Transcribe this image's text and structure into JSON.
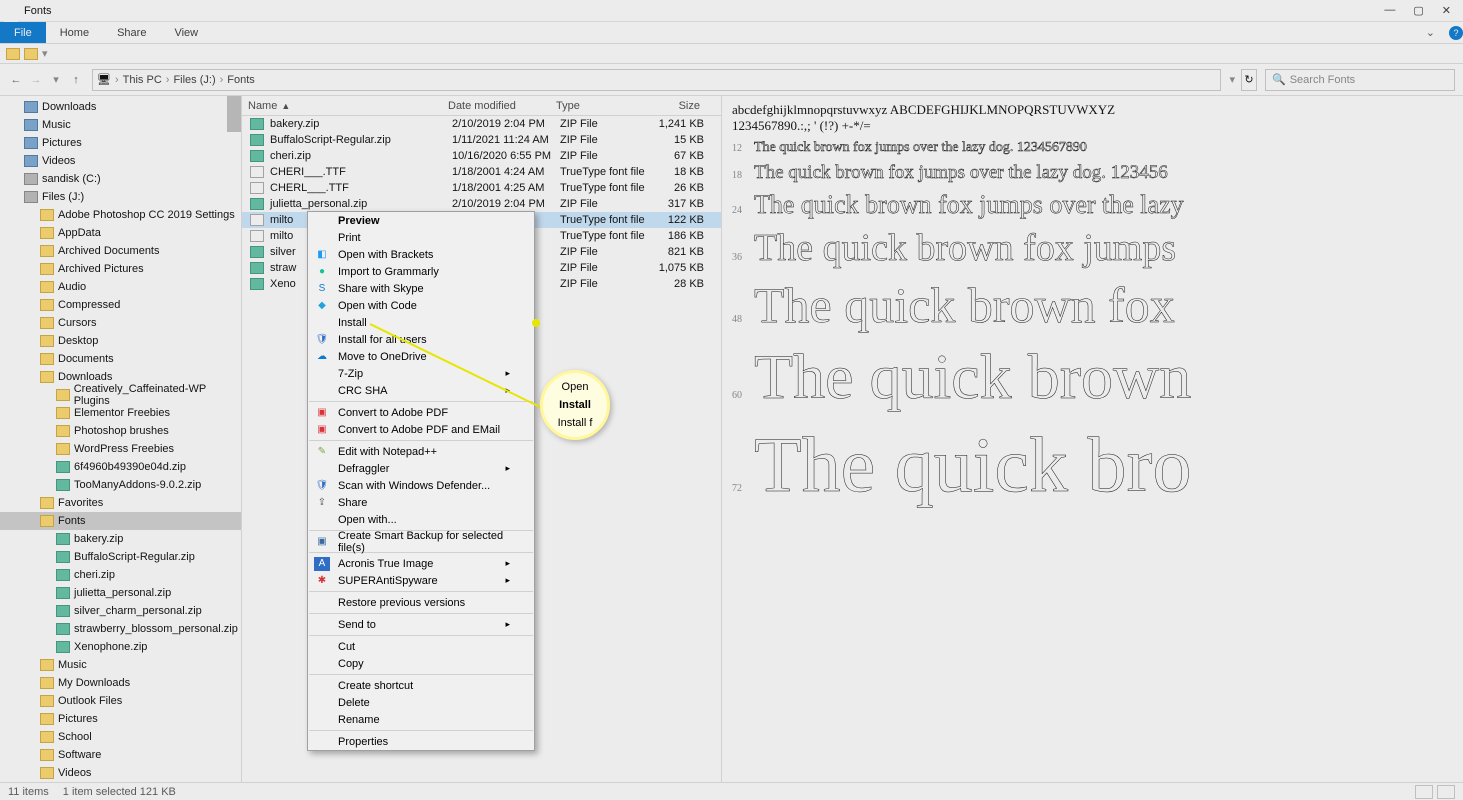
{
  "window": {
    "title": "Fonts"
  },
  "ribbon": {
    "file": "File",
    "home": "Home",
    "share": "Share",
    "view": "View"
  },
  "breadcrumb": {
    "root_icon": "pc",
    "parts": [
      "This PC",
      "Files (J:)",
      "Fonts"
    ],
    "refresh": "↻"
  },
  "search": {
    "placeholder": "Search Fonts"
  },
  "sidebar": {
    "items": [
      {
        "label": "Downloads",
        "ico": "lib",
        "lvl": 1
      },
      {
        "label": "Music",
        "ico": "lib",
        "lvl": 1
      },
      {
        "label": "Pictures",
        "ico": "lib",
        "lvl": 1
      },
      {
        "label": "Videos",
        "ico": "lib",
        "lvl": 1
      },
      {
        "label": "sandisk (C:)",
        "ico": "drive",
        "lvl": 1
      },
      {
        "label": "Files (J:)",
        "ico": "drive",
        "lvl": 1
      },
      {
        "label": "Adobe Photoshop CC 2019 Settings",
        "ico": "folder",
        "lvl": 2
      },
      {
        "label": "AppData",
        "ico": "folder",
        "lvl": 2
      },
      {
        "label": "Archived Documents",
        "ico": "folder",
        "lvl": 2
      },
      {
        "label": "Archived Pictures",
        "ico": "folder",
        "lvl": 2
      },
      {
        "label": "Audio",
        "ico": "folder",
        "lvl": 2
      },
      {
        "label": "Compressed",
        "ico": "folder",
        "lvl": 2
      },
      {
        "label": "Cursors",
        "ico": "folder",
        "lvl": 2
      },
      {
        "label": "Desktop",
        "ico": "folder",
        "lvl": 2
      },
      {
        "label": "Documents",
        "ico": "folder",
        "lvl": 2
      },
      {
        "label": "Downloads",
        "ico": "folder",
        "lvl": 2
      },
      {
        "label": "Creatively_Caffeinated-WP Plugins",
        "ico": "folder",
        "lvl": 3
      },
      {
        "label": "Elementor Freebies",
        "ico": "folder",
        "lvl": 3
      },
      {
        "label": "Photoshop brushes",
        "ico": "folder",
        "lvl": 3
      },
      {
        "label": "WordPress Freebies",
        "ico": "folder",
        "lvl": 3
      },
      {
        "label": "6f4960b49390e04d.zip",
        "ico": "zip",
        "lvl": 3
      },
      {
        "label": "TooManyAddons-9.0.2.zip",
        "ico": "zip",
        "lvl": 3
      },
      {
        "label": "Favorites",
        "ico": "folder",
        "lvl": 2
      },
      {
        "label": "Fonts",
        "ico": "folder",
        "lvl": 2,
        "selected": true
      },
      {
        "label": "bakery.zip",
        "ico": "zip",
        "lvl": 3
      },
      {
        "label": "BuffaloScript-Regular.zip",
        "ico": "zip",
        "lvl": 3
      },
      {
        "label": "cheri.zip",
        "ico": "zip",
        "lvl": 3
      },
      {
        "label": "julietta_personal.zip",
        "ico": "zip",
        "lvl": 3
      },
      {
        "label": "silver_charm_personal.zip",
        "ico": "zip",
        "lvl": 3
      },
      {
        "label": "strawberry_blossom_personal.zip",
        "ico": "zip",
        "lvl": 3
      },
      {
        "label": "Xenophone.zip",
        "ico": "zip",
        "lvl": 3
      },
      {
        "label": "Music",
        "ico": "folder",
        "lvl": 2
      },
      {
        "label": "My Downloads",
        "ico": "folder",
        "lvl": 2
      },
      {
        "label": "Outlook Files",
        "ico": "folder",
        "lvl": 2
      },
      {
        "label": "Pictures",
        "ico": "folder",
        "lvl": 2
      },
      {
        "label": "School",
        "ico": "folder",
        "lvl": 2
      },
      {
        "label": "Software",
        "ico": "folder",
        "lvl": 2
      },
      {
        "label": "Videos",
        "ico": "folder",
        "lvl": 2
      }
    ]
  },
  "columns": {
    "name": "Name",
    "date": "Date modified",
    "type": "Type",
    "size": "Size"
  },
  "files": [
    {
      "name": "bakery.zip",
      "date": "2/10/2019 2:04 PM",
      "type": "ZIP File",
      "size": "1,241 KB",
      "ico": "zip"
    },
    {
      "name": "BuffaloScript-Regular.zip",
      "date": "1/11/2021 11:24 AM",
      "type": "ZIP File",
      "size": "15 KB",
      "ico": "zip"
    },
    {
      "name": "cheri.zip",
      "date": "10/16/2020 6:55 PM",
      "type": "ZIP File",
      "size": "67 KB",
      "ico": "zip"
    },
    {
      "name": "CHERI___.TTF",
      "date": "1/18/2001 4:24 AM",
      "type": "TrueType font file",
      "size": "18 KB",
      "ico": "ttf"
    },
    {
      "name": "CHERL___.TTF",
      "date": "1/18/2001 4:25 AM",
      "type": "TrueType font file",
      "size": "26 KB",
      "ico": "ttf"
    },
    {
      "name": "julietta_personal.zip",
      "date": "2/10/2019 2:04 PM",
      "type": "ZIP File",
      "size": "317 KB",
      "ico": "zip"
    },
    {
      "name": "milto",
      "date": "",
      "type": "TrueType font file",
      "size": "122 KB",
      "ico": "ttf",
      "selected": true
    },
    {
      "name": "milto",
      "date": "",
      "type": "TrueType font file",
      "size": "186 KB",
      "ico": "ttf"
    },
    {
      "name": "silver",
      "date": "",
      "type": "ZIP File",
      "size": "821 KB",
      "ico": "zip"
    },
    {
      "name": "straw",
      "date": "",
      "type": "ZIP File",
      "size": "1,075 KB",
      "ico": "zip"
    },
    {
      "name": "Xeno",
      "date": "",
      "type": "ZIP File",
      "size": "28 KB",
      "ico": "zip"
    }
  ],
  "context_menu": {
    "preview": "Preview",
    "print": "Print",
    "open_brackets": "Open with Brackets",
    "import_grammarly": "Import to Grammarly",
    "share_skype": "Share with Skype",
    "open_code": "Open with Code",
    "install": "Install",
    "install_all": "Install for all users",
    "onedrive": "Move to OneDrive",
    "sevenzip": "7-Zip",
    "crc": "CRC SHA",
    "convert_pdf": "Convert to Adobe PDF",
    "convert_pdf_email": "Convert to Adobe PDF and EMail",
    "edit_npp": "Edit with Notepad++",
    "defraggler": "Defraggler",
    "scan_defender": "Scan with Windows Defender...",
    "share": "Share",
    "open_with": "Open with...",
    "smart_backup": "Create Smart Backup for selected file(s)",
    "acronis": "Acronis True Image",
    "superanti": "SUPERAntiSpyware",
    "restore": "Restore previous versions",
    "send_to": "Send to",
    "cut": "Cut",
    "copy": "Copy",
    "create_shortcut": "Create shortcut",
    "delete": "Delete",
    "rename": "Rename",
    "properties": "Properties"
  },
  "callout": {
    "l1": "Open",
    "l2": "Install",
    "l3": "Install f"
  },
  "preview": {
    "alpha1": "abcdefghijklmnopqrstuvwxyz ABCDEFGHIJKLMNOPQRSTUVWXYZ",
    "alpha2": "1234567890.:,; ' (!?) +-*/=",
    "lines": [
      {
        "sz": "12",
        "txt": "The quick brown fox jumps over the lazy dog. 1234567890"
      },
      {
        "sz": "18",
        "txt": "The quick brown fox jumps over the lazy dog. 123456"
      },
      {
        "sz": "24",
        "txt": "The quick brown fox jumps over the lazy"
      },
      {
        "sz": "36",
        "txt": "The quick brown fox jumps"
      },
      {
        "sz": "48",
        "txt": "The quick brown fox"
      },
      {
        "sz": "60",
        "txt": "The quick brown"
      },
      {
        "sz": "72",
        "txt": "The quick bro"
      }
    ]
  },
  "status": {
    "items": "11 items",
    "selected": "1 item selected  121 KB"
  }
}
